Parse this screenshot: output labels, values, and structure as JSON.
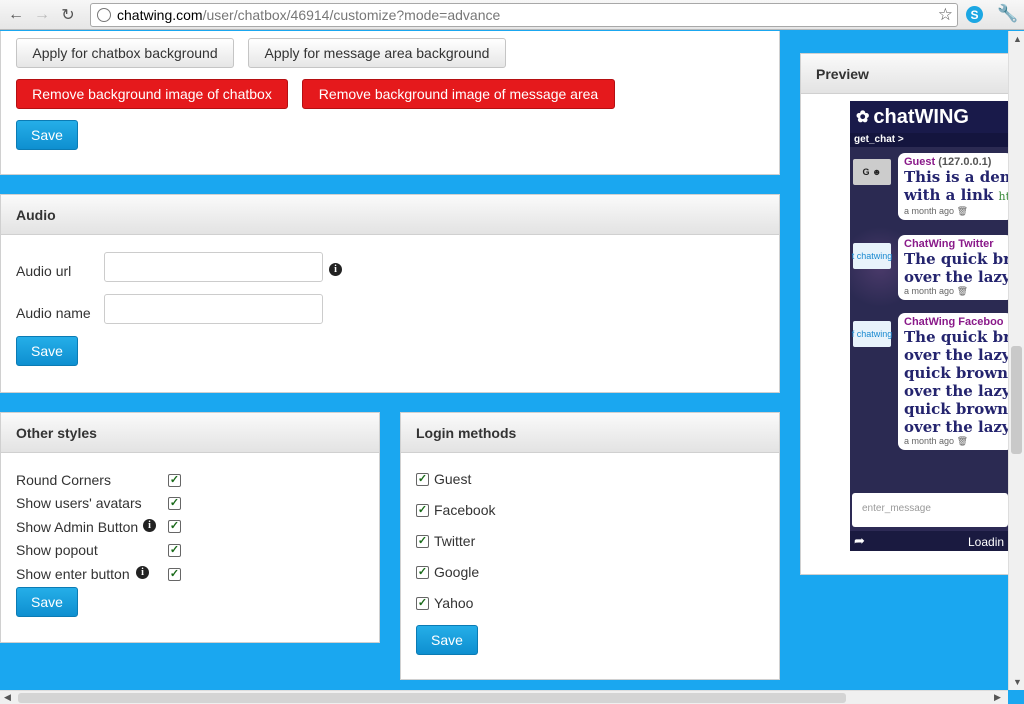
{
  "browser": {
    "url_host": "chatwing.com",
    "url_path": "/user/chatbox/46914/customize?mode=advance"
  },
  "background_panel": {
    "apply_chatbox_bg": "Apply for chatbox background",
    "apply_message_bg": "Apply for message area background",
    "remove_chatbox_bg": "Remove background image of chatbox",
    "remove_message_bg": "Remove background image of message area",
    "save": "Save"
  },
  "audio_panel": {
    "title": "Audio",
    "audio_url_label": "Audio url",
    "audio_url_value": "",
    "audio_name_label": "Audio name",
    "audio_name_value": "",
    "save": "Save"
  },
  "other_styles": {
    "title": "Other styles",
    "items": [
      {
        "label": "Round Corners",
        "checked": true,
        "info": false
      },
      {
        "label": "Show users' avatars",
        "checked": true,
        "info": false
      },
      {
        "label": "Show Admin Button",
        "checked": true,
        "info": true
      },
      {
        "label": "Show popout",
        "checked": true,
        "info": false
      },
      {
        "label": "Show enter button",
        "checked": true,
        "info": true
      }
    ],
    "save": "Save"
  },
  "login_methods": {
    "title": "Login methods",
    "items": [
      {
        "label": "Guest",
        "checked": true
      },
      {
        "label": "Facebook",
        "checked": true
      },
      {
        "label": "Twitter",
        "checked": true
      },
      {
        "label": "Google",
        "checked": true
      },
      {
        "label": "Yahoo",
        "checked": true
      }
    ],
    "save": "Save"
  },
  "preview": {
    "title": "Preview",
    "logo_text": "chatWING",
    "subheader": "get_chat  >",
    "messages": [
      {
        "badge": "G",
        "user": "Guest",
        "ip": "(127.0.0.1)",
        "lines": [
          "This is a dem",
          "with a link"
        ],
        "link": "htt",
        "time": "a month ago"
      },
      {
        "badge": "t",
        "user": "ChatWing Twitter",
        "ip": "",
        "lines": [
          "The quick bro",
          "over the lazy"
        ],
        "link": "",
        "time": "a month ago"
      },
      {
        "badge": "f",
        "user": "ChatWing Faceboo",
        "ip": "",
        "lines": [
          "The quick bro",
          "over the lazy",
          "quick brown",
          "over the lazy",
          "quick brown",
          "over the lazy"
        ],
        "link": "",
        "time": "a month ago"
      }
    ],
    "input_placeholder": "enter_message",
    "footer_status": "Loadin",
    "avatar_caption": "chatwing"
  },
  "colors": {
    "page_bg": "#1aa7f0",
    "save_button": "#1a9fdc",
    "remove_button": "#e5191c",
    "username": "#8a1a8a"
  }
}
